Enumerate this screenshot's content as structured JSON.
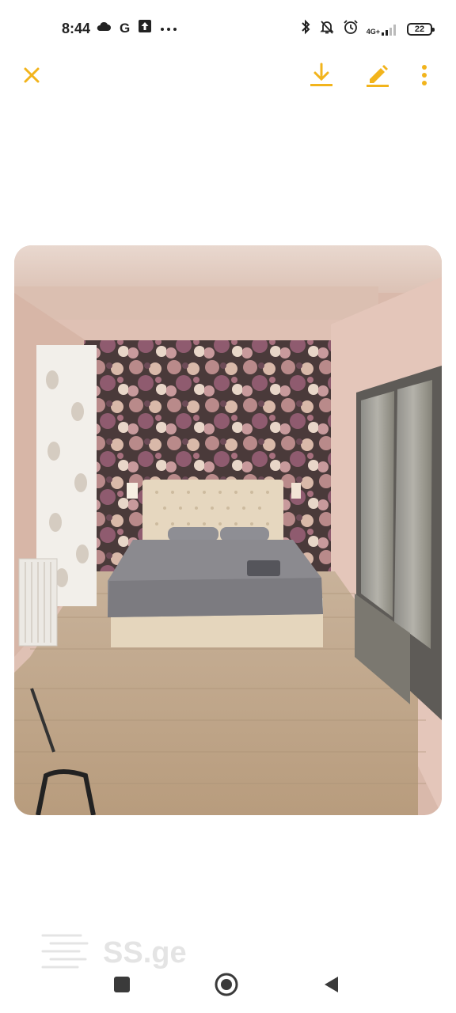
{
  "status_bar": {
    "time": "8:44",
    "left_glyphs": {
      "google": "G"
    },
    "network": "4G+",
    "battery": "22",
    "icons": [
      "cloud-icon",
      "google-icon",
      "upload-icon",
      "more-dots-icon",
      "bluetooth-icon",
      "mute-bell-icon",
      "alarm-icon",
      "signal-icon",
      "battery-icon"
    ]
  },
  "toolbar": {
    "accent_color": "#f2b41c",
    "icons": [
      "close-icon",
      "download-icon",
      "edit-icon",
      "overflow-menu-icon"
    ]
  },
  "photo": {
    "subject": "bedroom"
  },
  "watermark": {
    "text": "SS.ge"
  },
  "navbar": {
    "icons": [
      "recents-square-icon",
      "home-circle-icon",
      "back-triangle-icon"
    ]
  }
}
